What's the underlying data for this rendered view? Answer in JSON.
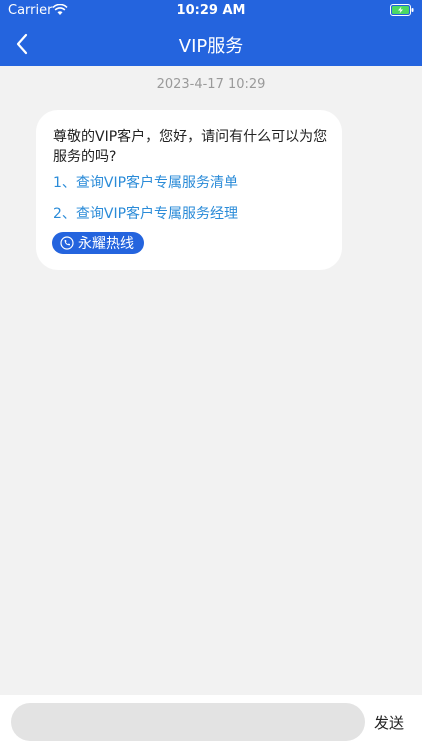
{
  "status_bar": {
    "carrier": "Carrier",
    "time": "10:29 AM"
  },
  "nav": {
    "title": "VIP服务"
  },
  "chat": {
    "timestamp": "2023-4-17 10:29",
    "greeting": "尊敬的VIP客户，您好，请问有什么可以为您服务的吗?",
    "links": [
      "1、查询VIP客户专属服务清单",
      "2、查询VIP客户专属服务经理"
    ],
    "hotline_label": "永耀热线"
  },
  "input": {
    "placeholder": "",
    "send_label": "发送"
  },
  "colors": {
    "brand": "#2464de",
    "link": "#2a8bd8",
    "background": "#f2f2f2"
  }
}
